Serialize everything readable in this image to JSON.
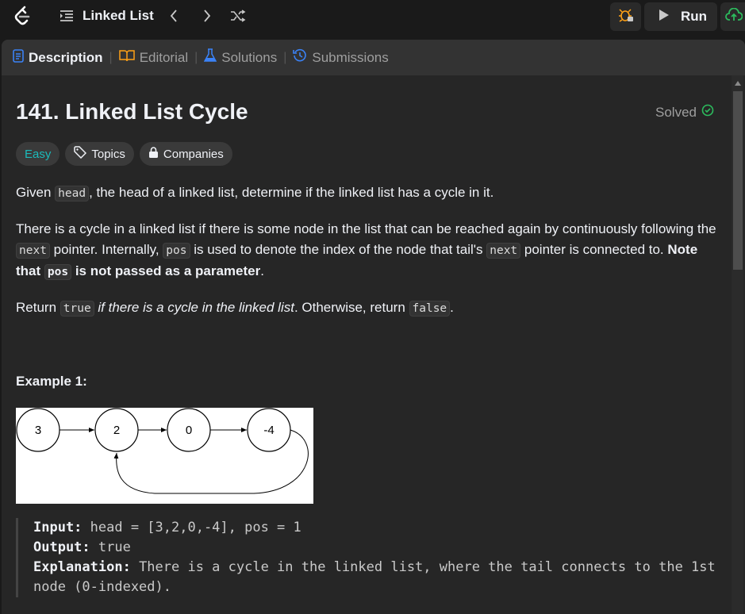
{
  "topbar": {
    "list_title": "Linked List",
    "run_label": "Run"
  },
  "tabs": [
    {
      "label": "Description"
    },
    {
      "label": "Editorial"
    },
    {
      "label": "Solutions"
    },
    {
      "label": "Submissions"
    }
  ],
  "problem": {
    "title": "141. Linked List Cycle",
    "status": "Solved",
    "difficulty": "Easy",
    "topics_label": "Topics",
    "companies_label": "Companies"
  },
  "description": {
    "p1_a": "Given ",
    "p1_code": "head",
    "p1_b": ", the head of a linked list, determine if the linked list has a cycle in it.",
    "p2_a": "There is a cycle in a linked list if there is some node in the list that can be reached again by continuously following the ",
    "p2_code1": "next",
    "p2_b": " pointer. Internally, ",
    "p2_code2": "pos",
    "p2_c": " is used to denote the index of the node that tail's ",
    "p2_code3": "next",
    "p2_d": " pointer is connected to. ",
    "p2_bold_a": "Note that ",
    "p2_bold_code": "pos",
    "p2_bold_b": " is not passed as a parameter",
    "p2_end": ".",
    "p3_a": "Return ",
    "p3_code1": "true",
    "p3_italic": " if there is a cycle in the linked list",
    "p3_b": ". Otherwise, return ",
    "p3_code2": "false",
    "p3_end": "."
  },
  "example1": {
    "heading": "Example 1:",
    "nodes": [
      "3",
      "2",
      "0",
      "-4"
    ],
    "input_label": "Input:",
    "input_value": " head = [3,2,0,-4], pos = 1",
    "output_label": "Output:",
    "output_value": " true",
    "explanation_label": "Explanation:",
    "explanation_value": " There is a cycle in the linked list, where the tail connects to the 1st node (0-indexed)."
  },
  "colors": {
    "accent_easy": "#1cbaba",
    "solved_green": "#2cbb5d",
    "submit_green": "#2cbb5d",
    "debug_orange": "#ffa116"
  }
}
